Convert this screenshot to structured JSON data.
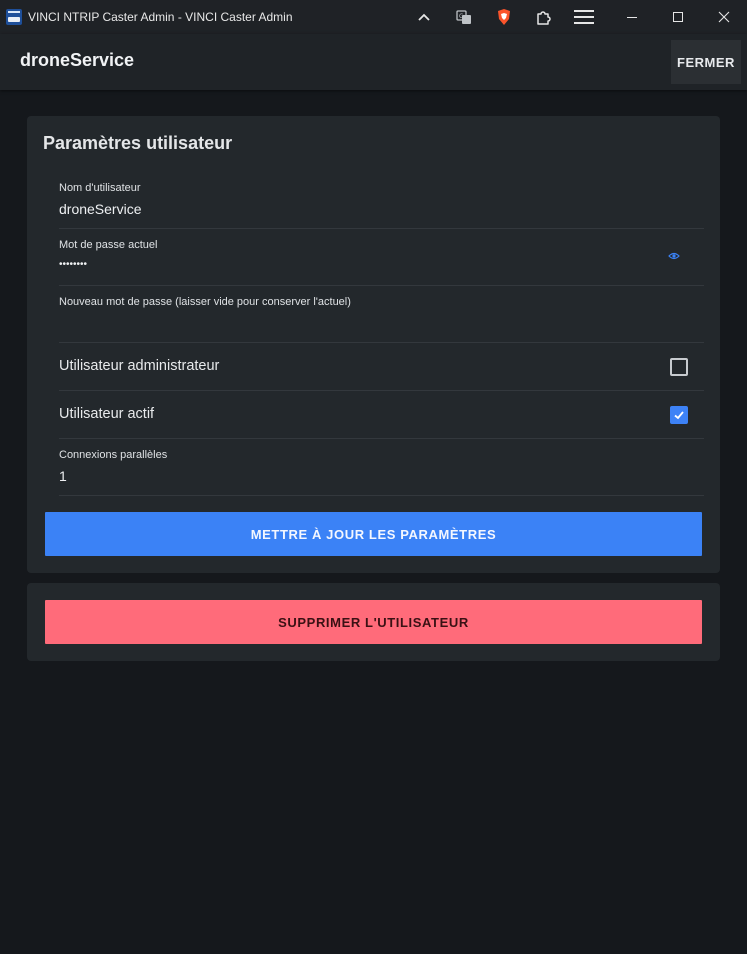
{
  "window": {
    "title": "VINCI NTRIP Caster Admin - VINCI Caster Admin",
    "toolbar_icons": [
      "chevron-up-icon",
      "translate-icon",
      "brave-shield-icon",
      "extensions-icon",
      "menu-icon"
    ],
    "controls": [
      "minimize-icon",
      "maximize-icon",
      "close-icon"
    ]
  },
  "header": {
    "title": "droneService",
    "close_label": "FERMER"
  },
  "settings": {
    "title": "Paramètres utilisateur",
    "username": {
      "label": "Nom d'utilisateur",
      "value": "droneService"
    },
    "current_password": {
      "label": "Mot de passe actuel",
      "value": "••••••••"
    },
    "new_password": {
      "label": "Nouveau mot de passe (laisser vide pour conserver l'actuel)",
      "value": ""
    },
    "admin": {
      "label": "Utilisateur administrateur",
      "checked": false
    },
    "active": {
      "label": "Utilisateur actif",
      "checked": true
    },
    "connections": {
      "label": "Connexions parallèles",
      "value": "1"
    },
    "update_label": "METTRE À JOUR LES PARAMÈTRES"
  },
  "danger": {
    "delete_label": "SUPPRIMER L'UTILISATEUR"
  },
  "colors": {
    "primary": "#3b82f6",
    "danger": "#ff6b7a",
    "background": "#15181c",
    "card": "#23282c"
  }
}
